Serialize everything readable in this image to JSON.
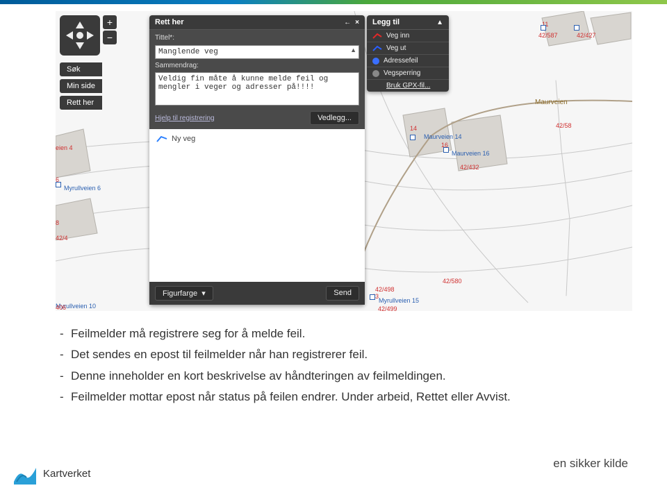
{
  "side_menu": {
    "sok": "Søk",
    "minside": "Min side",
    "rett": "Rett her"
  },
  "rett_panel": {
    "title": "Rett her",
    "titleLabel": "Tittel*:",
    "titleValue": "Manglende veg",
    "summaryLabel": "Sammendrag:",
    "summaryValue": "Veldig fin måte å kunne melde feil og mengler i veger og adresser på!!!!",
    "helpLink": "Hjelp til registrering",
    "attachBtn": "Vedlegg...",
    "newLayer": "Ny veg",
    "figureColor": "Figurfarge",
    "sendBtn": "Send"
  },
  "legg_panel": {
    "title": "Legg til",
    "items": [
      {
        "label": "Veg inn",
        "color": "#e02828",
        "shape": "line"
      },
      {
        "label": "Veg ut",
        "color": "#2a5fff",
        "shape": "line"
      },
      {
        "label": "Adressefeil",
        "color": "#3a6fff",
        "shape": "dot"
      },
      {
        "label": "Vegsperring",
        "color": "#888",
        "shape": "dot"
      },
      {
        "label": "Bruk GPX-fil...",
        "color": "",
        "shape": ""
      }
    ]
  },
  "map": {
    "streets": {
      "maurveien": "Maurveien",
      "myrull": "Myrullveien"
    },
    "addresses": {
      "mv14": "Maurveien 14",
      "mv16": "Maurveien 16",
      "my6": "Myrullveien 6",
      "my10": "Myrullveien 10",
      "my15": "Myrullveien 15"
    },
    "parcels": {
      "p587": "42/587",
      "p427": "42/427",
      "p58": "42/58",
      "p432": "42/432",
      "p580": "42/580",
      "p498": "42/498",
      "p499": "42/499",
      "p4": "eien 4",
      "p406": "406",
      "p43": "43",
      "p6": "6",
      "p8": "8",
      "p14": "14",
      "p16": "16",
      "p11": "11",
      "p424": "42/4"
    }
  },
  "bullets": {
    "b1": "Feilmelder må registrere seg for å melde feil.",
    "b2": "Det sendes en epost til feilmelder når han registrerer feil.",
    "b3": "Denne inneholder en kort beskrivelse av håndteringen av feilmeldingen.",
    "b4": "Feilmelder mottar epost når status på feilen endrer. Under arbeid, Rettet eller Avvist."
  },
  "footer": {
    "brand": "Kartverket",
    "tagline": "en sikker kilde"
  }
}
